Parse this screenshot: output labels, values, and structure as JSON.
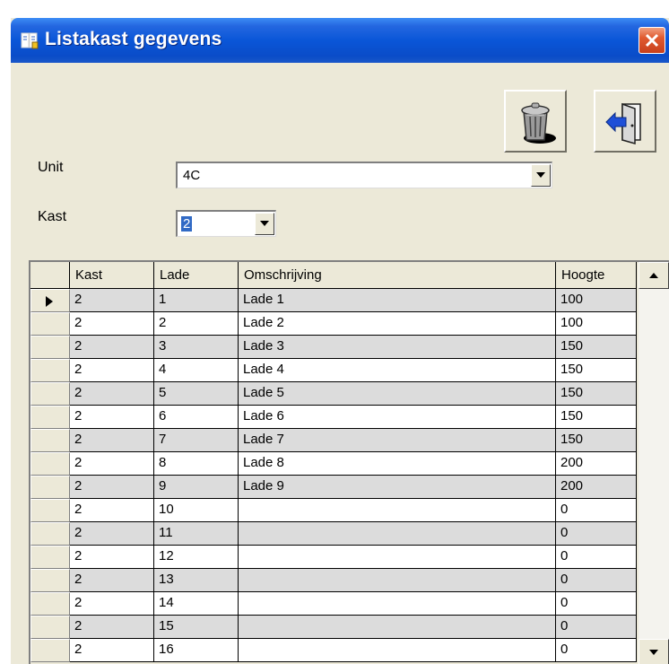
{
  "window": {
    "title": "Listakast gegevens"
  },
  "toolbar": {
    "delete_icon": "trash-can-icon",
    "exit_icon": "exit-door-icon"
  },
  "form": {
    "unit_label": "Unit",
    "unit_value": "4C",
    "kast_label": "Kast",
    "kast_value": "2"
  },
  "grid": {
    "columns": [
      "Kast",
      "Lade",
      "Omschrijving",
      "Hoogte"
    ],
    "rows": [
      [
        "2",
        "1",
        "Lade 1",
        "100"
      ],
      [
        "2",
        "2",
        "Lade 2",
        "100"
      ],
      [
        "2",
        "3",
        "Lade 3",
        "150"
      ],
      [
        "2",
        "4",
        "Lade 4",
        "150"
      ],
      [
        "2",
        "5",
        "Lade 5",
        "150"
      ],
      [
        "2",
        "6",
        "Lade 6",
        "150"
      ],
      [
        "2",
        "7",
        "Lade 7",
        "150"
      ],
      [
        "2",
        "8",
        "Lade 8",
        "200"
      ],
      [
        "2",
        "9",
        "Lade 9",
        "200"
      ],
      [
        "2",
        "10",
        "",
        "0"
      ],
      [
        "2",
        "11",
        "",
        "0"
      ],
      [
        "2",
        "12",
        "",
        "0"
      ],
      [
        "2",
        "13",
        "",
        "0"
      ],
      [
        "2",
        "14",
        "",
        "0"
      ],
      [
        "2",
        "15",
        "",
        "0"
      ],
      [
        "2",
        "16",
        "",
        "0"
      ]
    ],
    "current_row": 0
  },
  "colors": {
    "titlebar": "#0a56d8",
    "window_bg": "#ece9d8",
    "row_alt": "#dcdcdc",
    "selection": "#316ac5"
  }
}
